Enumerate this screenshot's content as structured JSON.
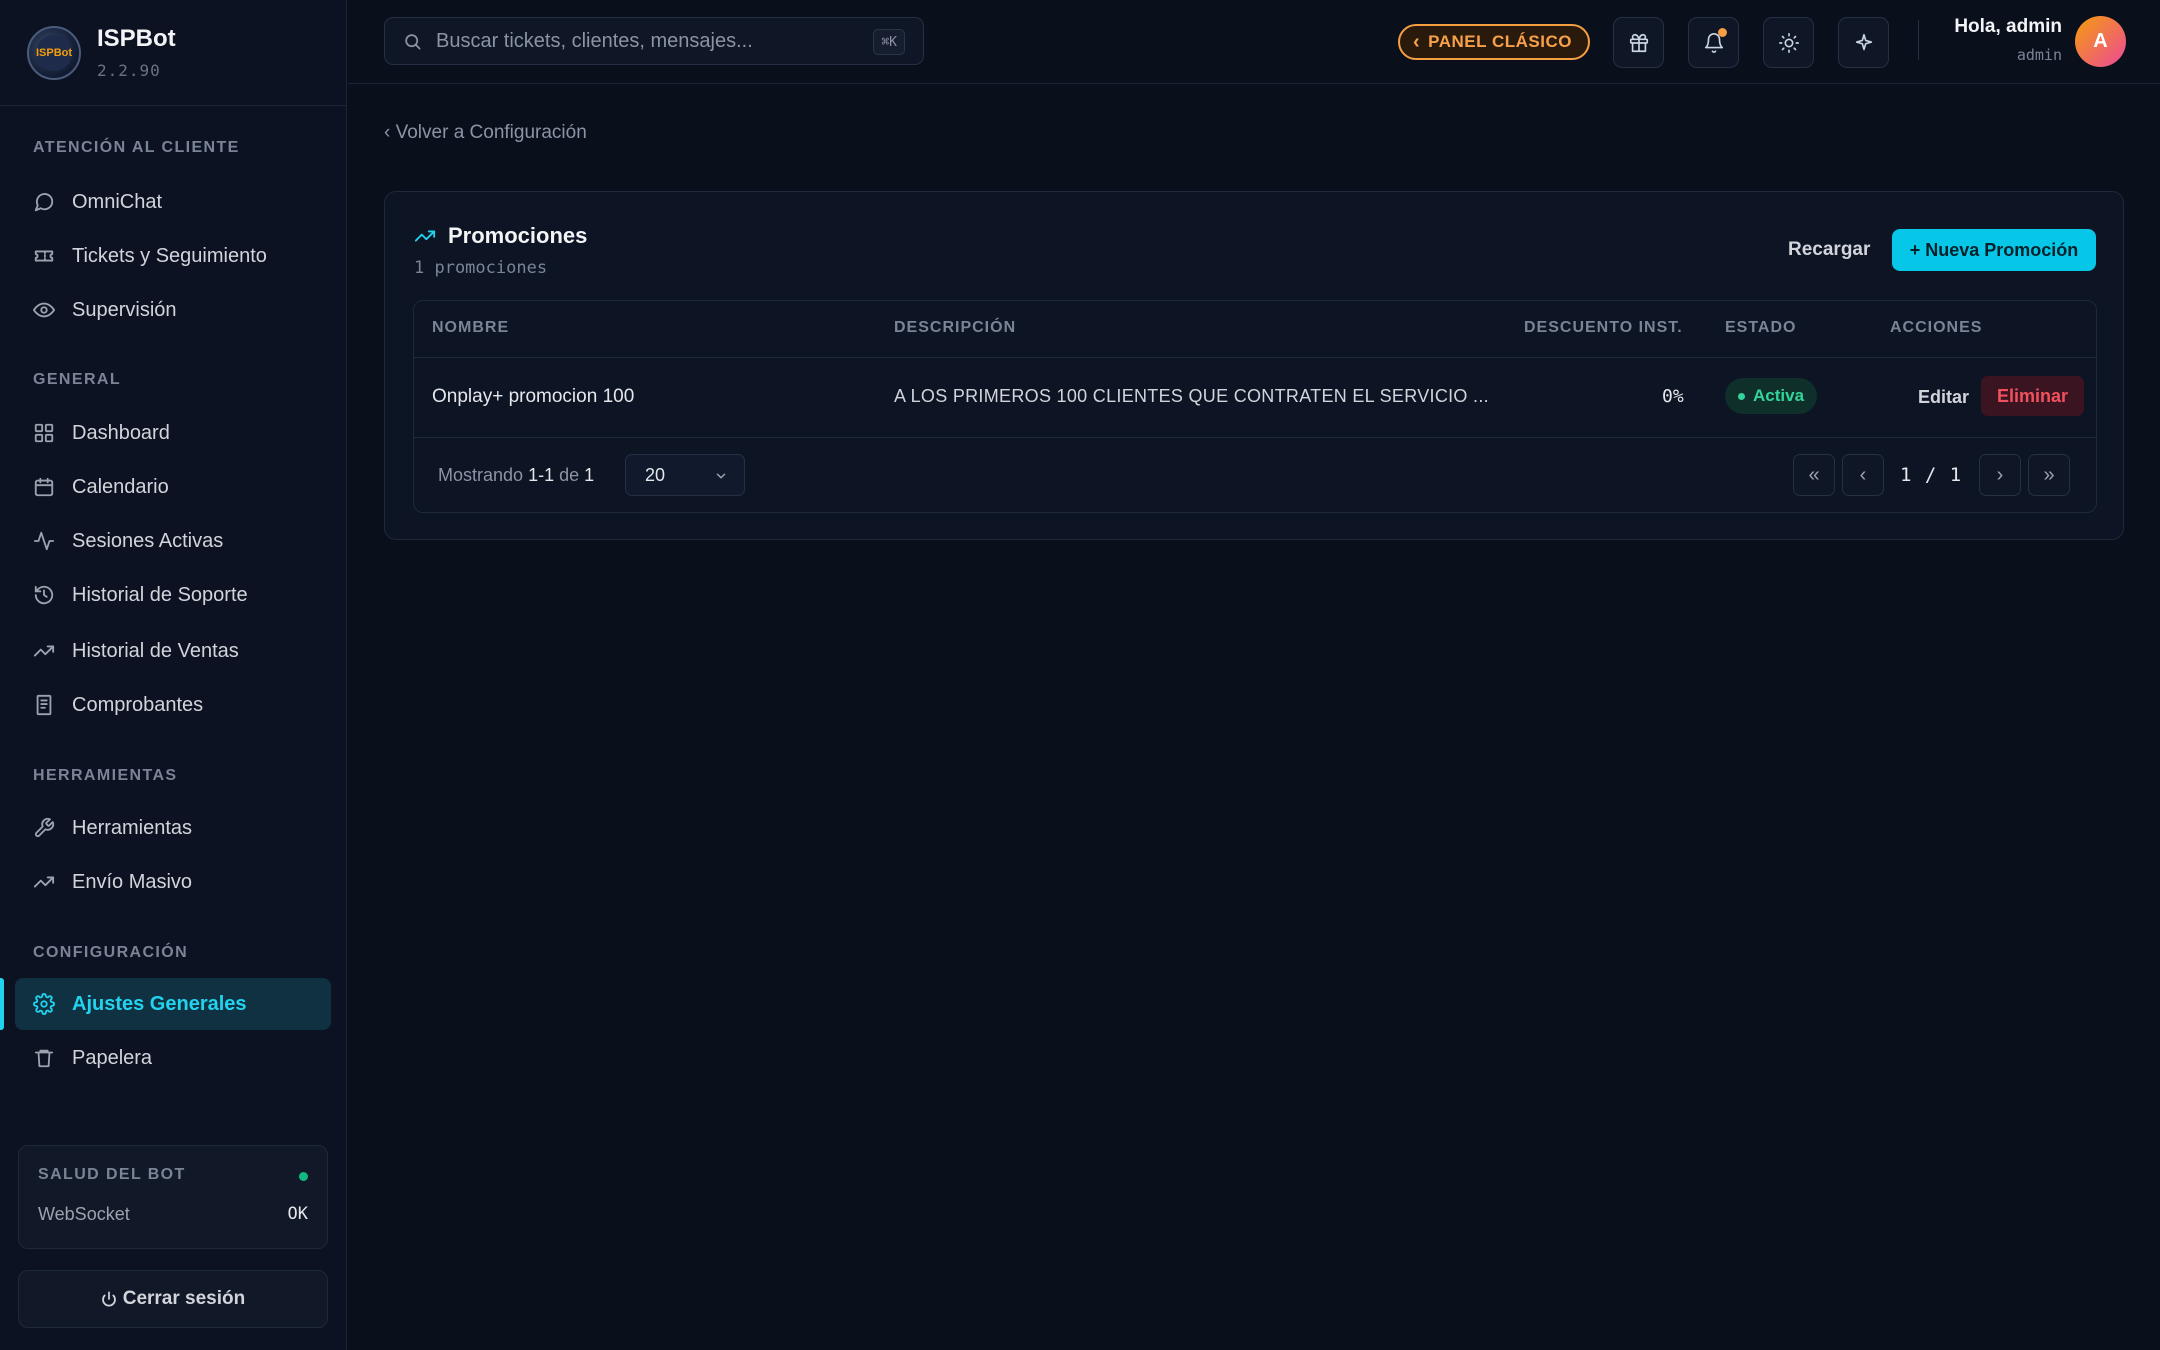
{
  "brand": {
    "name": "ISPBot",
    "version": "2.2.90",
    "logo_text": "ISPBot"
  },
  "sidebar": {
    "sections": [
      {
        "label": "ATENCIÓN AL CLIENTE",
        "items": [
          {
            "label": "OmniChat",
            "icon": "chat-icon"
          },
          {
            "label": "Tickets y Seguimiento",
            "icon": "ticket-icon"
          },
          {
            "label": "Supervisión",
            "icon": "eye-icon"
          }
        ]
      },
      {
        "label": "GENERAL",
        "items": [
          {
            "label": "Dashboard",
            "icon": "grid-icon"
          },
          {
            "label": "Calendario",
            "icon": "calendar-icon"
          },
          {
            "label": "Sesiones Activas",
            "icon": "activity-icon"
          },
          {
            "label": "Historial de Soporte",
            "icon": "history-icon"
          },
          {
            "label": "Historial de Ventas",
            "icon": "trending-up-icon"
          },
          {
            "label": "Comprobantes",
            "icon": "receipt-icon"
          }
        ]
      },
      {
        "label": "HERRAMIENTAS",
        "items": [
          {
            "label": "Herramientas",
            "icon": "wrench-icon"
          },
          {
            "label": "Envío Masivo",
            "icon": "trending-up-icon"
          }
        ]
      },
      {
        "label": "CONFIGURACIÓN",
        "items": [
          {
            "label": "Ajustes Generales",
            "icon": "gear-icon",
            "active": true
          },
          {
            "label": "Papelera",
            "icon": "trash-icon"
          }
        ]
      }
    ],
    "health": {
      "title": "SALUD DEL BOT",
      "status_color": "#10b981",
      "row_label": "WebSocket",
      "row_value": "OK"
    },
    "logout_label": "Cerrar sesión"
  },
  "header": {
    "search_placeholder": "Buscar tickets, clientes, mensajes...",
    "search_shortcut": "⌘K",
    "classic_label": "PANEL CLÁSICO",
    "greeting": "Hola, admin",
    "role": "admin",
    "avatar_initial": "A"
  },
  "main": {
    "back_label": "‹ Volver a Configuración",
    "title": "Promociones",
    "subtitle": "1 promociones",
    "reload_label": "Recargar",
    "new_label": "+ Nueva Promoción",
    "columns": [
      "NOMBRE",
      "DESCRIPCIÓN",
      "DESCUENTO INST.",
      "ESTADO",
      "ACCIONES"
    ],
    "rows": [
      {
        "name": "Onplay+ promocion 100",
        "description": "A LOS PRIMEROS 100 CLIENTES QUE CONTRATEN EL SERVICIO ...",
        "discount": "0%",
        "status": "Activa",
        "edit": "Editar",
        "delete": "Eliminar"
      }
    ],
    "footer": {
      "showing_prefix": "Mostrando",
      "range": "1-1",
      "of": "de",
      "total": "1",
      "per_page": "20",
      "page_info": "1 / 1",
      "first": "«",
      "prev": "‹",
      "next": "›",
      "last": "»"
    }
  },
  "colors": {
    "accent": "#22d3ee",
    "primary_button": "#06c7e8",
    "classic_orange": "#f59e42",
    "danger": "#f0515e",
    "success": "#34d399"
  }
}
